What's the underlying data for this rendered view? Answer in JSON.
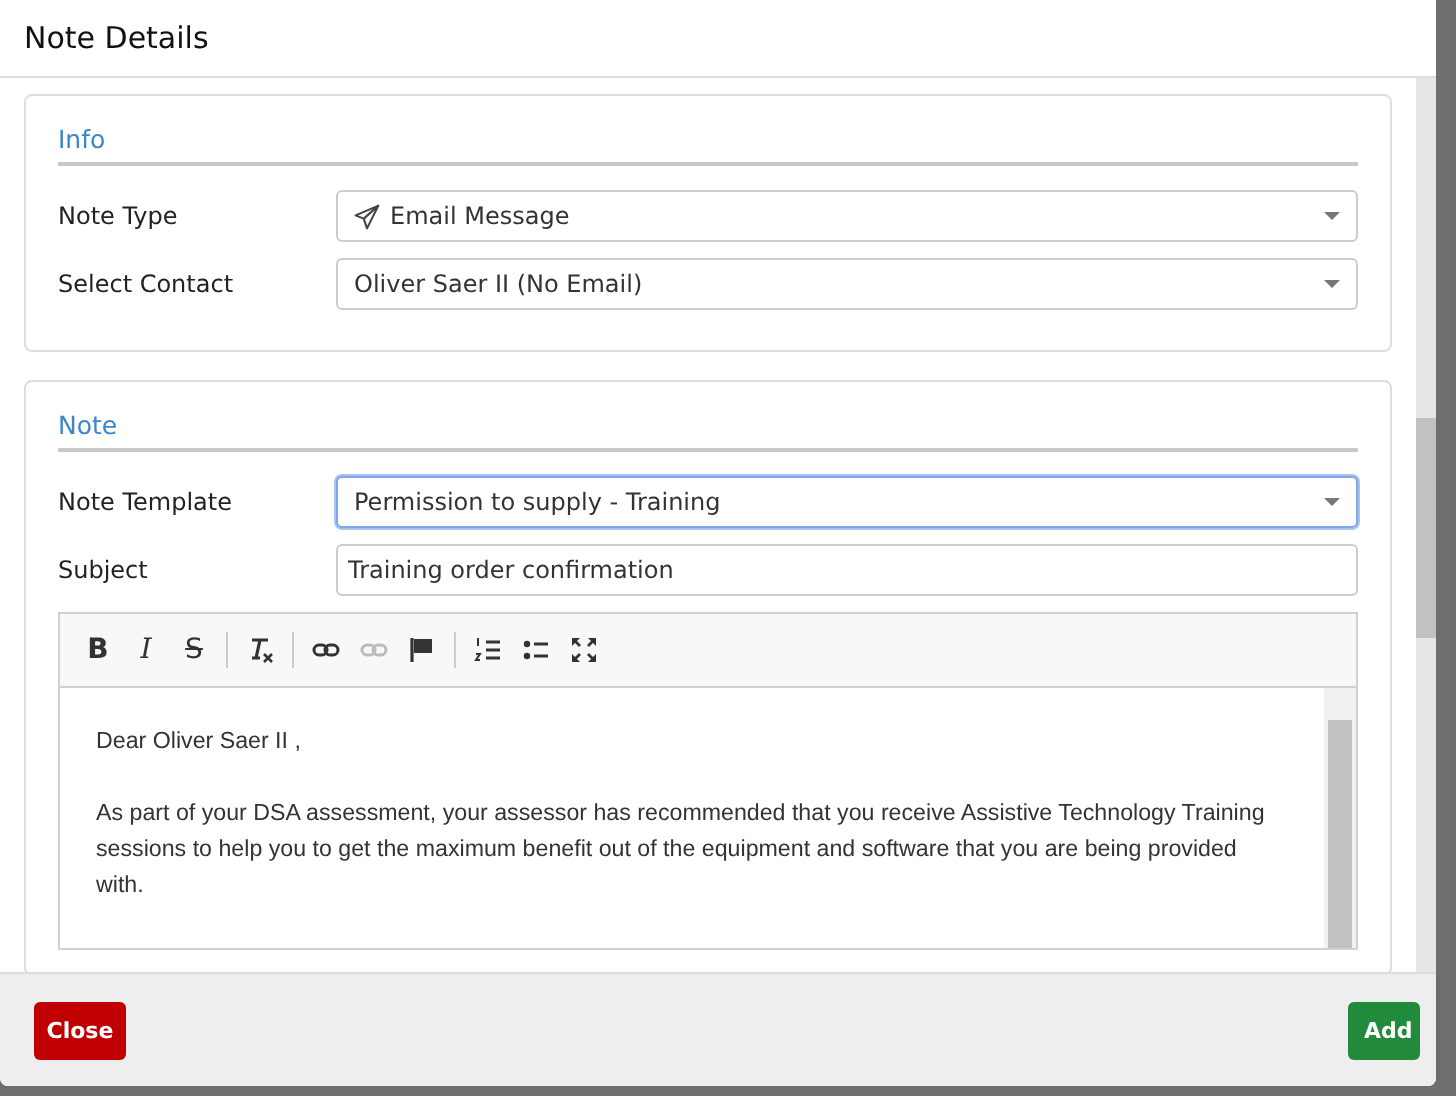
{
  "window": {
    "title": "Note Details"
  },
  "sections": [
    {
      "title": "Info",
      "fields": [
        {
          "label": "Note Type",
          "kind": "icon-select",
          "value": "Email Message",
          "focused": false
        },
        {
          "label": "Select Contact",
          "kind": "select",
          "value": "Oliver Saer II (No Email)",
          "focused": false
        }
      ]
    },
    {
      "title": "Note",
      "fields": [
        {
          "label": "Note Template",
          "kind": "select",
          "value": "Permission to supply - Training",
          "focused": true
        },
        {
          "label": "Subject",
          "kind": "text",
          "value": "Training order confirmation",
          "focused": false
        }
      ],
      "editor": {
        "toolbar": [
          {
            "kind": "bold",
            "label": "B",
            "disabled": false
          },
          {
            "kind": "italic",
            "label": "I",
            "disabled": false
          },
          {
            "kind": "strike",
            "label": "S",
            "disabled": false
          },
          {
            "kind": "separator"
          },
          {
            "kind": "remove-format",
            "disabled": false
          },
          {
            "kind": "separator"
          },
          {
            "kind": "link",
            "disabled": false
          },
          {
            "kind": "unlink",
            "disabled": true
          },
          {
            "kind": "flag",
            "disabled": false
          },
          {
            "kind": "separator"
          },
          {
            "kind": "numbered-list",
            "disabled": false
          },
          {
            "kind": "bulleted-list",
            "disabled": false
          },
          {
            "kind": "maximize",
            "disabled": false
          }
        ],
        "paragraphs": [
          "Dear Oliver Saer II ,",
          "As part of your DSA assessment, your assessor has recommended that you receive Assistive Technology Training sessions to help you to get the maximum benefit out of the equipment and software that you are being provided with."
        ]
      }
    }
  ],
  "footer": {
    "buttons": [
      {
        "label": "Close",
        "kind": "danger"
      },
      {
        "label": "Add",
        "kind": "primary"
      }
    ]
  }
}
